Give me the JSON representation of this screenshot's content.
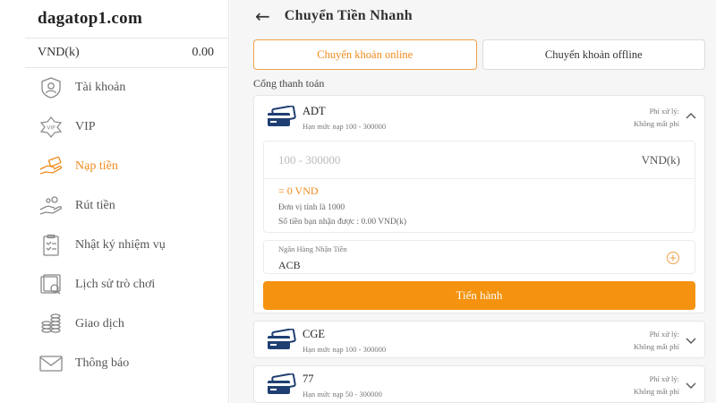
{
  "sidebar": {
    "brand": "dagatop1.com",
    "balance": {
      "label": "VND(k)",
      "value": "0.00"
    },
    "items": [
      {
        "label": "Tài khoản",
        "icon": "user-icon",
        "active": false
      },
      {
        "label": "VIP",
        "icon": "vip-icon",
        "active": false
      },
      {
        "label": "Nạp tiền",
        "icon": "deposit-icon",
        "active": true
      },
      {
        "label": "Rút tiền",
        "icon": "withdraw-icon",
        "active": false
      },
      {
        "label": "Nhật ký nhiệm vụ",
        "icon": "task-log-icon",
        "active": false
      },
      {
        "label": "Lịch sử trò chơi",
        "icon": "game-history-icon",
        "active": false
      },
      {
        "label": "Giao dịch",
        "icon": "transaction-icon",
        "active": false
      },
      {
        "label": "Thông báo",
        "icon": "mail-icon",
        "active": false
      }
    ]
  },
  "header": {
    "title": "Chuyển Tiền Nhanh",
    "back_icon": "←"
  },
  "tabs": [
    {
      "label": "Chuyển khoản online",
      "active": true
    },
    {
      "label": "Chuyển khoản offline",
      "active": false
    }
  ],
  "section_label": "Cổng thanh toán",
  "gateways": [
    {
      "name": "ADT",
      "limit": "Hạn mức nạp 100 - 300000",
      "fee_label": "Phí xử lý:",
      "fee_value": "Không mất phí",
      "expanded": true
    },
    {
      "name": "CGE",
      "limit": "Hạn mức nạp 100 - 300000",
      "fee_label": "Phí xử lý:",
      "fee_value": "Không mất phí",
      "expanded": false
    },
    {
      "name": "77",
      "limit": "Hạn mức nạp 50 - 300000",
      "fee_label": "Phí xử lý:",
      "fee_value": "Không mất phí",
      "expanded": false
    }
  ],
  "form": {
    "amount_placeholder": "100 - 300000",
    "amount_value": "",
    "unit": "VND(k)",
    "converted": "= 0 VND",
    "unit_note": "Đơn vị tính là 1000",
    "received_note": "Số tiền bạn nhận được : 0.00 VND(k)",
    "bank_label": "Ngân Hàng Nhận Tiền",
    "bank_value": "ACB",
    "submit_label": "Tiến hành"
  },
  "colors": {
    "accent": "#f08a1c",
    "button": "#f5920f",
    "card_icon": "#1f3f73"
  }
}
